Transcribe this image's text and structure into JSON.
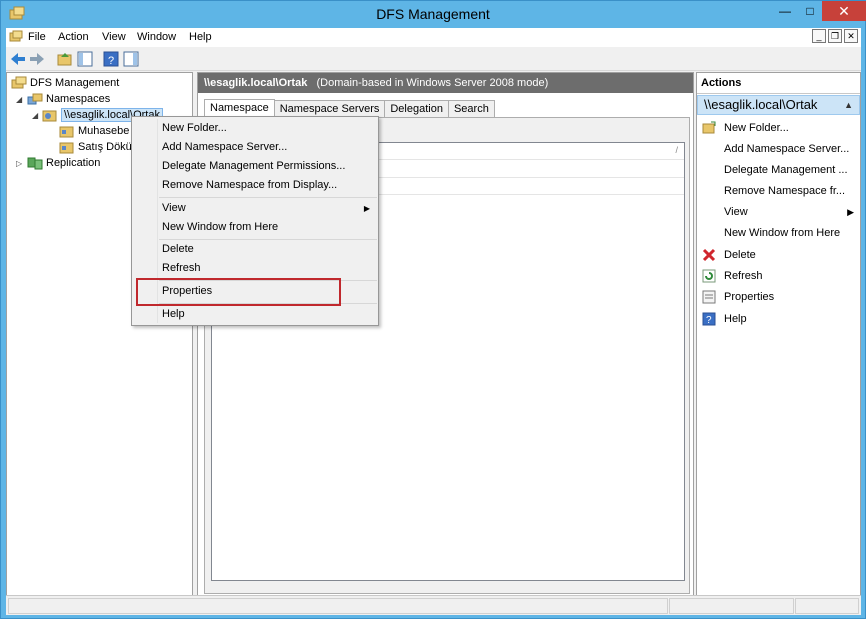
{
  "window": {
    "title": "DFS Management"
  },
  "menubar": {
    "items": [
      "File",
      "Action",
      "View",
      "Window",
      "Help"
    ]
  },
  "tree": {
    "root": "DFS Management",
    "namespaces": "Namespaces",
    "namespace_item": "\\\\esaglik.local\\Ortak",
    "children": [
      "Muhasebe D",
      "Satış Dökün"
    ],
    "replication": "Replication"
  },
  "center": {
    "header_bold": "\\\\esaglik.local\\Ortak",
    "header_rest": "(Domain-based in Windows Server 2008 mode)",
    "tabs": [
      "Namespace",
      "Namespace Servers",
      "Delegation",
      "Search"
    ],
    "active_tab": "Namespace"
  },
  "context_menu": {
    "items": [
      "New Folder...",
      "Add Namespace Server...",
      "Delegate Management Permissions...",
      "Remove Namespace from Display...",
      "View",
      "New Window from Here",
      "Delete",
      "Refresh",
      "Properties",
      "Help"
    ],
    "highlighted": "Properties"
  },
  "actions": {
    "title": "Actions",
    "subtitle": "\\\\esaglik.local\\Ortak",
    "items": [
      {
        "label": "New Folder...",
        "icon": "new-folder-icon"
      },
      {
        "label": "Add Namespace Server...",
        "icon": "none"
      },
      {
        "label": "Delegate Management ...",
        "icon": "none"
      },
      {
        "label": "Remove Namespace fr...",
        "icon": "none"
      },
      {
        "label": "View",
        "icon": "none"
      },
      {
        "label": "New Window from Here",
        "icon": "none"
      },
      {
        "label": "Delete",
        "icon": "delete-icon"
      },
      {
        "label": "Refresh",
        "icon": "refresh-icon"
      },
      {
        "label": "Properties",
        "icon": "properties-icon"
      },
      {
        "label": "Help",
        "icon": "help-icon"
      }
    ]
  },
  "colors": {
    "titlebar": "#5eb5e6",
    "selection": "#cce4f7",
    "highlight_box": "#c0282d",
    "close": "#c7413a"
  }
}
